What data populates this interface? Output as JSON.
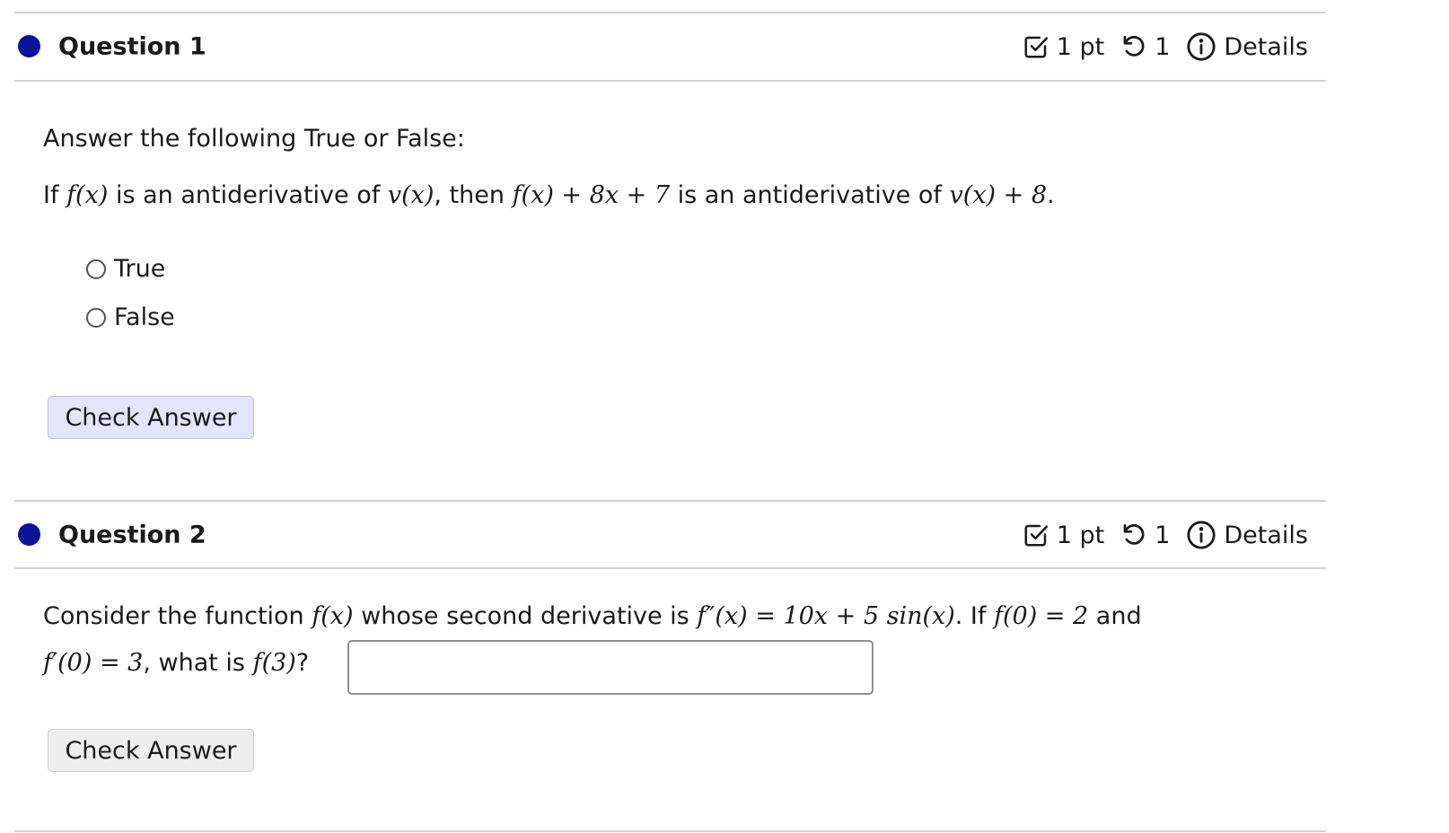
{
  "questions": [
    {
      "title": "Question 1",
      "status_color": "#0b1399",
      "points": "1 pt",
      "attempts": "1",
      "details_label": "Details",
      "icons": [
        "checkbox-check-icon",
        "retry-icon",
        "info-icon"
      ],
      "prompt": "Answer the following True or False:",
      "statement": {
        "t1": "If ",
        "m1": "f(x)",
        "t2": " is an antiderivative of ",
        "m2": "v(x)",
        "t3": ", then ",
        "m3": "f(x) + 8x + 7",
        "t4": " is an antiderivative of ",
        "m4": "v(x) + 8",
        "t5": "."
      },
      "choices": [
        {
          "label": "True",
          "selected": false
        },
        {
          "label": "False",
          "selected": false
        }
      ],
      "check_label": "Check Answer"
    },
    {
      "title": "Question 2",
      "status_color": "#0b1399",
      "points": "1 pt",
      "attempts": "1",
      "details_label": "Details",
      "icons": [
        "checkbox-check-icon",
        "retry-icon",
        "info-icon"
      ],
      "line1": {
        "t1": "Consider the function ",
        "m1": "f(x)",
        "t2": " whose second derivative is ",
        "m2": "f″(x) = 10x + 5 sin(x)",
        "t3": ". If ",
        "m3": "f(0) = 2",
        "t4": " and"
      },
      "line2": {
        "m1": "f′(0) = 3",
        "t1": ", what is ",
        "m2": "f(3)",
        "t2": "?"
      },
      "answer_value": "",
      "answer_placeholder": "",
      "check_label": "Check Answer"
    }
  ]
}
